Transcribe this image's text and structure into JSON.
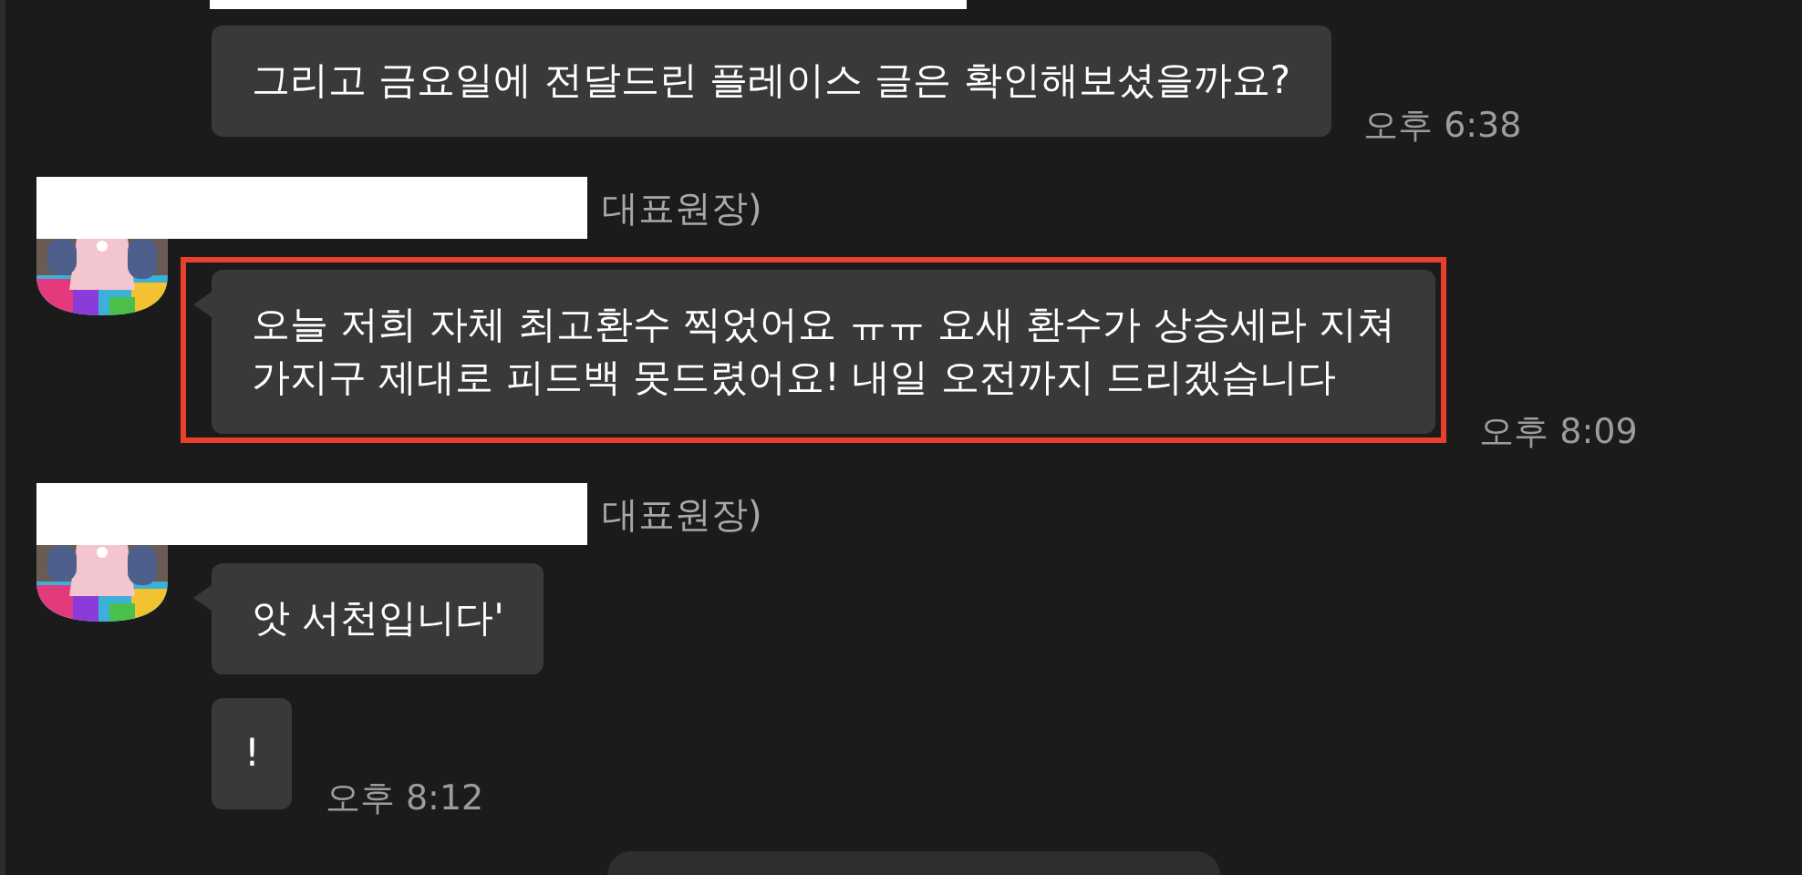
{
  "groups": [
    {
      "bubbles": [
        {
          "text": "그리고 금요일에 전달드린 플레이스 글은 확인해보셨을까요?",
          "time": "오후 6:38",
          "highlighted": false
        }
      ]
    },
    {
      "sender": "대표원장)",
      "bubbles": [
        {
          "text": "오늘 저희 자체 최고환수 찍었어요 ㅠㅠ 요새 환수가 상승세라 지쳐\n가지구 제대로 피드백 못드렸어요! 내일 오전까지 드리겠습니다",
          "time": "오후 8:09",
          "highlighted": true
        }
      ]
    },
    {
      "sender": "대표원장)",
      "bubbles": [
        {
          "text": "앗 서천입니다'",
          "highlighted": false
        },
        {
          "text": "!",
          "time": "오후 8:12",
          "highlighted": false
        }
      ]
    }
  ]
}
